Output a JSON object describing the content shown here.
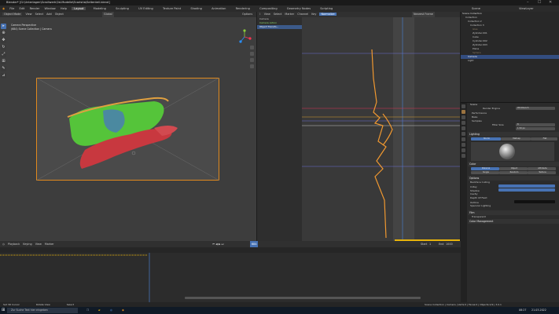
{
  "window": {
    "title": "Blender* [G:\\Unterlagen\\Scrollwerk\\3d-Modelle\\Ecaristia\\Seitenteil.blend]",
    "controls": [
      "–",
      "☐",
      "✕"
    ]
  },
  "menu": {
    "items": [
      "File",
      "Edit",
      "Render",
      "Window",
      "Help"
    ],
    "workspaces": [
      "Layout",
      "Modeling",
      "Sculpting",
      "UV Editing",
      "Texture Paint",
      "Shading",
      "Animation",
      "Rendering",
      "Compositing",
      "Geometry Nodes",
      "Scripting"
    ],
    "active_workspace": "Layout",
    "scene": "Scene",
    "view_layer": "ViewLayer"
  },
  "viewport": {
    "mode": "Object Mode",
    "menus": [
      "View",
      "Select",
      "Add",
      "Object"
    ],
    "orientation": "Global",
    "options": "Options",
    "overlay_line1": "Camera Perspective",
    "overlay_line2": "(684) Scene Collection | Camera",
    "tools": [
      "select",
      "cursor",
      "move",
      "rotate",
      "scale",
      "transform",
      "annotate",
      "measure"
    ]
  },
  "graph_editor": {
    "menus": [
      "View",
      "Select",
      "Marker",
      "Channel",
      "Key"
    ],
    "normalize": "Normalize",
    "pivot": "Nearest Frame",
    "channels": [
      {
        "label": "Camera",
        "style": "normal"
      },
      {
        "label": "Camera Action",
        "style": "green"
      },
      {
        "label": "Object Transfo...",
        "style": "sel"
      }
    ],
    "highlight_buttons": [
      "Add",
      "Auto",
      "Fast",
      "Fine"
    ]
  },
  "timeline": {
    "playback": "Playback",
    "keying": "Keying",
    "view": "View",
    "marker": "Marker",
    "current_frame": "684",
    "start_label": "Start",
    "start": "1",
    "end_label": "End",
    "end": "1000"
  },
  "outliner": {
    "title": "Scene Collection",
    "rows": [
      {
        "label": "Collection",
        "style": "normal"
      },
      {
        "label": "Collection 2",
        "style": "normal"
      },
      {
        "label": "Collection 3",
        "style": "normal"
      },
      {
        "label": "Glas",
        "style": "dim"
      },
      {
        "label": "Zylinder.001",
        "style": "normal"
      },
      {
        "label": "Cube",
        "style": "normal"
      },
      {
        "label": "Cylinder.002",
        "style": "normal"
      },
      {
        "label": "Zylinder.003",
        "style": "normal"
      },
      {
        "label": "Plane",
        "style": "normal"
      },
      {
        "label": "Sphere",
        "style": "dim"
      },
      {
        "label": "Camera",
        "style": "sel"
      },
      {
        "label": "Light",
        "style": "normal"
      }
    ]
  },
  "properties": {
    "object": "Scene",
    "render_engine_label": "Render Engine",
    "render_engine": "Workbench",
    "sections": [
      "Performance",
      "Bake",
      "Lighting",
      "Color",
      "Options",
      "Film",
      "Color Management"
    ],
    "lighting_tabs": [
      "Studio",
      "Matcap",
      "Flat"
    ],
    "color_options": [
      "Material",
      "Object",
      "Attribute",
      "Single",
      "Random",
      "Texture"
    ],
    "rows": {
      "backface": "Backface Culling",
      "xray": "X-Ray",
      "shadow": "Shadow",
      "cavity": "Cavity",
      "dof": "Depth Of Field",
      "outline": "Outline",
      "specular": "Specular Lighting",
      "transparent": "Transparent",
      "samples": "Samples",
      "filter": "Filter Size",
      "filter_value": "1.50 px",
      "sampling_value": "8"
    }
  },
  "statusbar": {
    "left": [
      "Set 3D Cursor",
      "Rotate View",
      "Select"
    ],
    "right": "Scene Collection | Camera | Verts:0 | Faces:0 | Objects:1/9 | 3.0.1"
  },
  "taskbar": {
    "search_placeholder": "Zur Suche Text hier eingeben",
    "clock_time": "08:27",
    "clock_date": "21.03.2022"
  },
  "colors": {
    "accent": "#4772b3",
    "curve": "#f09830",
    "camera_frame": "#e08a1e",
    "highlight": "#e8b40b",
    "green_mesh": "#55c43a",
    "red_mesh": "#c8383f"
  }
}
